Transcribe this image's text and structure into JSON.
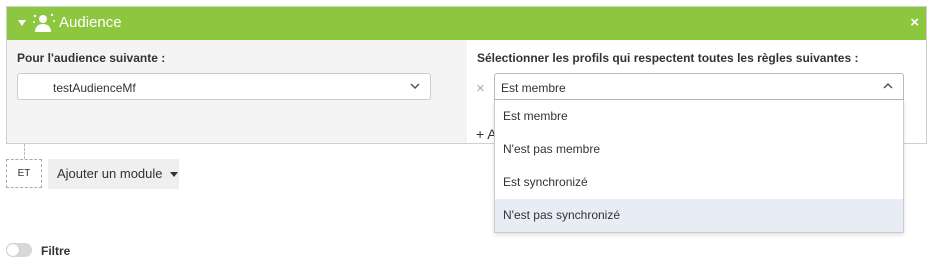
{
  "panel": {
    "title": "Audience",
    "close_symbol": "×",
    "header_color": "#8dc63f",
    "icons": {
      "collapse": "caret-down-icon",
      "title": "audience-user-icon",
      "close": "close-icon"
    }
  },
  "audience": {
    "label": "Pour l'audience suivante :",
    "selected": "testAudienceMf"
  },
  "rules": {
    "label": "Sélectionner les profils qui respectent toutes les règles suivantes :",
    "remove_symbol": "×",
    "selected": "Est membre",
    "add_prefix": "+ A",
    "options": [
      "Est membre",
      "N'est pas membre",
      "Est synchronizé",
      "N'est pas synchronizé"
    ],
    "highlighted_option": "N'est pas synchronizé"
  },
  "logic": {
    "operator": "ET",
    "add_module_label": "Ajouter un module"
  },
  "filter": {
    "label": "Filtre",
    "enabled": false
  }
}
